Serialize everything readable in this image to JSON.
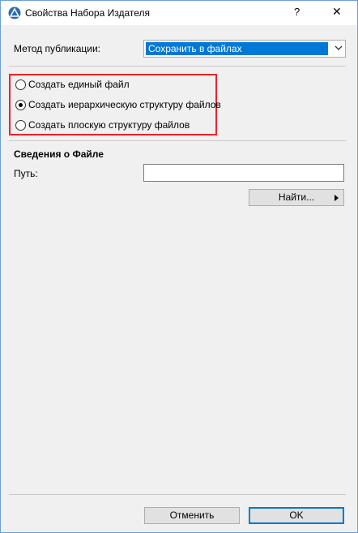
{
  "window": {
    "title": "Свойства Набора Издателя",
    "help": "?",
    "close": "✕"
  },
  "publish": {
    "label": "Метод публикации:",
    "selected": "Сохранить в файлах"
  },
  "options": [
    {
      "label": "Создать единый файл",
      "checked": false
    },
    {
      "label": "Создать иерархическую структуру файлов",
      "checked": true
    },
    {
      "label": "Создать плоскую структуру файлов",
      "checked": false
    }
  ],
  "file_info": {
    "heading": "Сведения о Файле",
    "path_label": "Путь:",
    "path_value": "",
    "find_label": "Найти..."
  },
  "footer": {
    "cancel_label": "Отменить",
    "ok_label": "OK"
  },
  "colors": {
    "highlight": "#e8242b",
    "accent": "#0078d7"
  }
}
